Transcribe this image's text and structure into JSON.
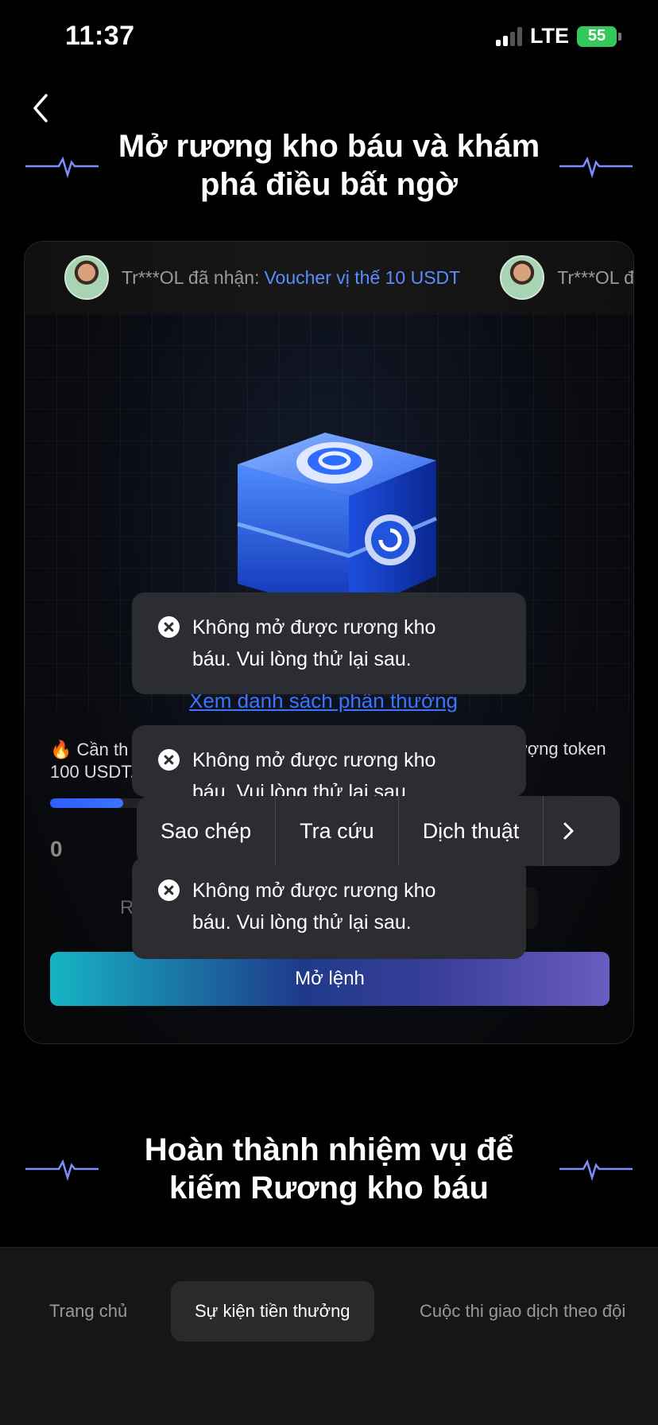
{
  "status_bar": {
    "time": "11:37",
    "network": "LTE",
    "battery": "55"
  },
  "header": {
    "back_icon": "chevron-left-icon",
    "title": "Mở rương kho báu và khám phá điều bất ngờ"
  },
  "ticker": {
    "items": [
      {
        "user": "Tr***OL đã nhận:",
        "reward": "Voucher vị thế 10 USDT"
      },
      {
        "user": "Tr***OL đã",
        "reward": ""
      }
    ]
  },
  "chest": {
    "icon": "treasure-chest-icon"
  },
  "rewards_link": "Xem danh sách phần thưởng",
  "progress": {
    "label_left_1": "🔥 Cần th",
    "label_left_2": "100 USDT.",
    "label_right": "ượng token",
    "value": "0",
    "fill_fraction": 0.13,
    "faded_text": "R"
  },
  "open_button": "Mở lệnh",
  "toasts": [
    {
      "icon": "error-circle-icon",
      "line1": "Không mở được rương kho",
      "line2": "báu. Vui lòng thử lại sau."
    },
    {
      "icon": "error-circle-icon",
      "line1": "Không mở được rương kho",
      "line2": "báu. Vui lòng thử lại sau."
    },
    {
      "icon": "error-circle-icon",
      "line1": "Không mở được rương kho",
      "line2": "báu. Vui lòng thử lại sau."
    }
  ],
  "context_menu": {
    "items": [
      "Sao chép",
      "Tra cứu",
      "Dịch thuật"
    ],
    "more_icon": "chevron-right-icon"
  },
  "section2": {
    "title": "Hoàn thành nhiệm vụ để kiếm Rương kho báu"
  },
  "bottom_nav": {
    "tabs": [
      "Trang chủ",
      "Sự kiện tiền thưởng",
      "Cuộc thi giao dịch theo đội"
    ],
    "active_index": 1
  },
  "colors": {
    "accent": "#3b74ff",
    "button_start": "#16b4c4",
    "button_end": "#6a5cc0",
    "toast_bg": "#2b2d33"
  }
}
